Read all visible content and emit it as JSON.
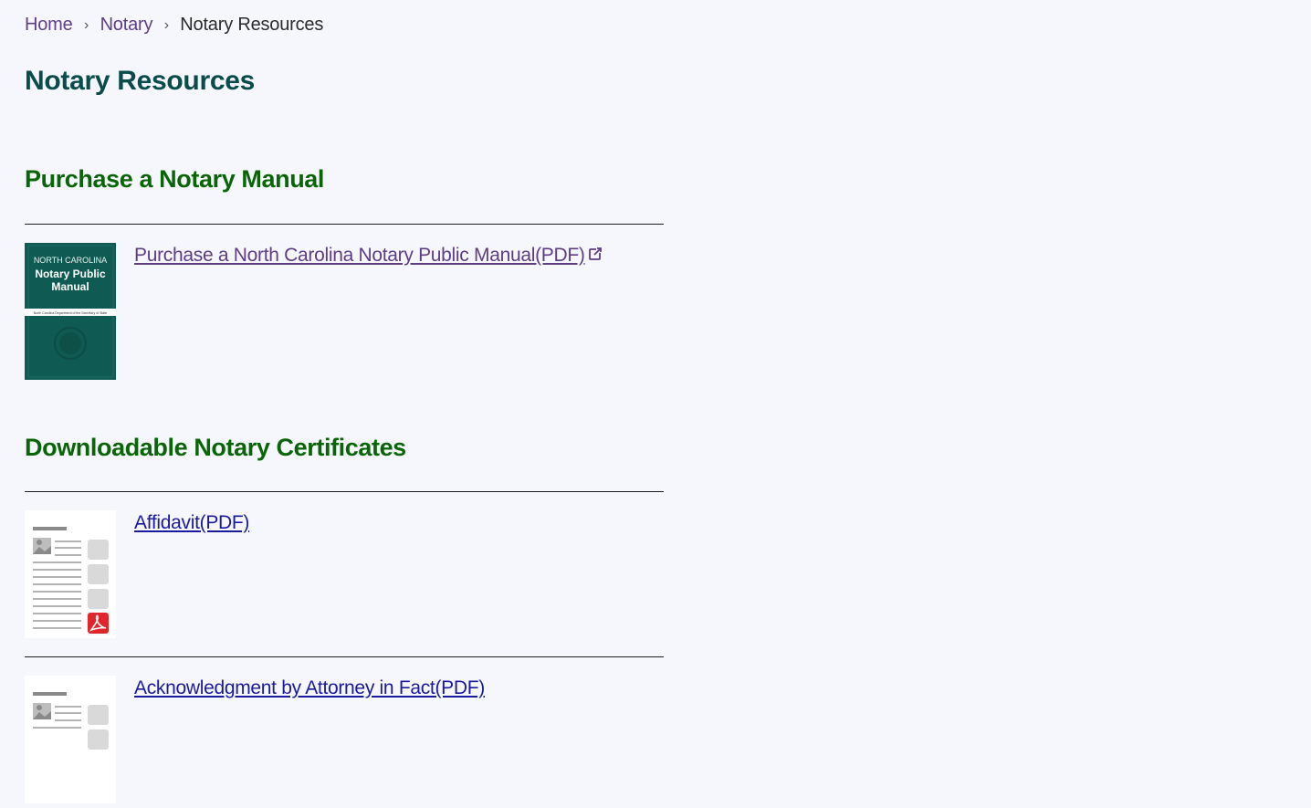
{
  "breadcrumb": {
    "items": [
      {
        "label": "Home"
      },
      {
        "label": "Notary"
      },
      {
        "label": "Notary Resources"
      }
    ],
    "separator_icon": "chevron-right-icon"
  },
  "page_title": "Notary Resources",
  "sections": [
    {
      "title": "Purchase a Notary Manual",
      "items": [
        {
          "link_text": "Purchase a North Carolina Notary Public Manual(PDF)",
          "external_icon": "external-link-icon",
          "thumbnail": {
            "type": "manual-cover",
            "line1": "NORTH CAROLINA",
            "line2": "Notary Public",
            "line3": "Manual",
            "footer": "North Carolina Department of the Secretary of State"
          }
        }
      ]
    },
    {
      "title": "Downloadable Notary Certificates",
      "items": [
        {
          "link_text": "Affidavit(PDF)",
          "thumbnail": {
            "type": "pdf-document-icon"
          }
        },
        {
          "link_text": "Acknowledgment by Attorney in Fact(PDF)",
          "thumbnail": {
            "type": "pdf-document-icon"
          }
        }
      ]
    }
  ],
  "colors": {
    "background": "#f6f7fc",
    "page_title": "#0a4b4b",
    "section_title": "#0a6408",
    "link_visited": "#5e3d85",
    "link": "#1a1a9e",
    "manual_cover": "#0f5a52",
    "pdf_badge": "#e0262b"
  }
}
